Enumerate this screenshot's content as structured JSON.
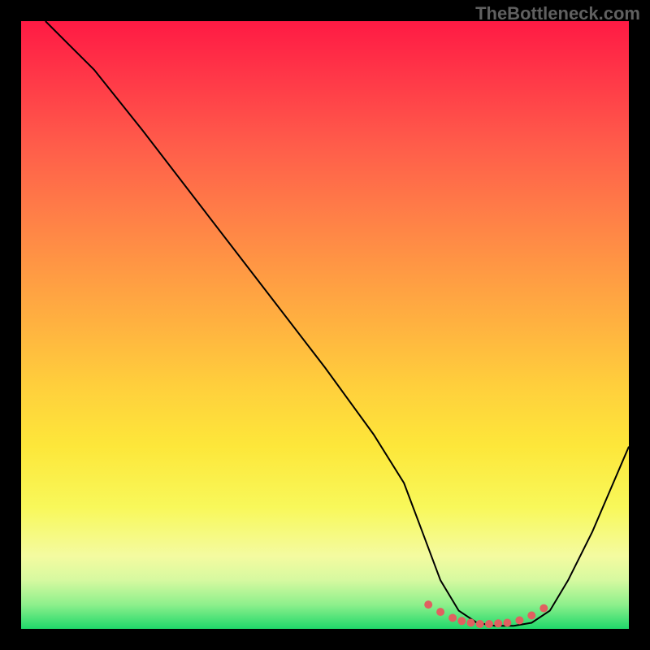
{
  "watermark": "TheBottleneck.com",
  "chart_data": {
    "type": "line",
    "title": "",
    "xlabel": "",
    "ylabel": "",
    "xlim": [
      0,
      100
    ],
    "ylim": [
      0,
      100
    ],
    "series": [
      {
        "name": "bottleneck-curve",
        "x": [
          4,
          8,
          12,
          20,
          30,
          40,
          50,
          58,
          63,
          66,
          69,
          72,
          75,
          78,
          81,
          84,
          87,
          90,
          94,
          100
        ],
        "y": [
          100,
          96,
          92,
          82,
          69,
          56,
          43,
          32,
          24,
          16,
          8,
          3,
          1,
          0.5,
          0.5,
          1,
          3,
          8,
          16,
          30
        ]
      }
    ],
    "markers": {
      "name": "trough-dots",
      "x": [
        67,
        69,
        71,
        72.5,
        74,
        75.5,
        77,
        78.5,
        80,
        82,
        84,
        86
      ],
      "y": [
        4,
        2.8,
        1.8,
        1.3,
        1,
        0.8,
        0.8,
        0.9,
        1,
        1.4,
        2.2,
        3.4
      ]
    },
    "background": {
      "type": "vertical-gradient",
      "stops": [
        {
          "pos": 0,
          "color": "#ff1a44"
        },
        {
          "pos": 50,
          "color": "#ffb240"
        },
        {
          "pos": 80,
          "color": "#f8f85a"
        },
        {
          "pos": 100,
          "color": "#1fd86a"
        }
      ]
    }
  }
}
